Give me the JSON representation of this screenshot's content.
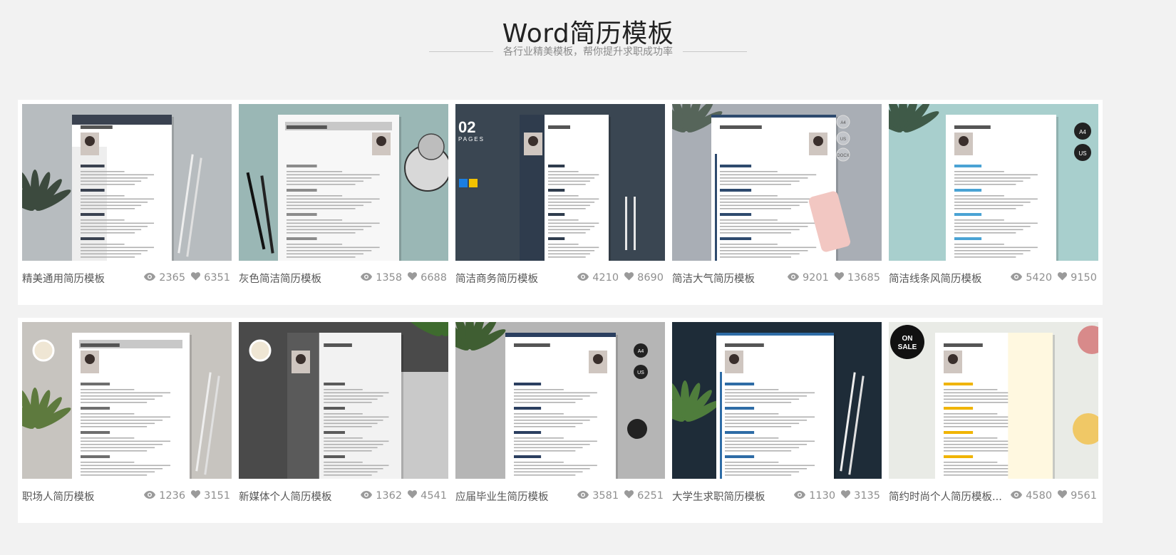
{
  "header": {
    "title": "Word简历模板",
    "subtitle": "各行业精美模板，帮你提升求职成功率"
  },
  "templates": [
    {
      "name": "精美通用简历模板",
      "views": "2365",
      "likes": "6351",
      "bg": "#b7bcbf",
      "paper": "#ffffff",
      "accent": "#3a4250",
      "plant": "#3c4a3e"
    },
    {
      "name": "灰色简洁简历模板",
      "views": "1358",
      "likes": "6688",
      "bg": "#9ab7b5",
      "paper": "#f7f7f7",
      "accent": "#8c8c8c",
      "plant": "#555555"
    },
    {
      "name": "简洁商务简历模板",
      "views": "4210",
      "likes": "8690",
      "bg": "#3a4652",
      "paper": "#ffffff",
      "accent": "#2f3c4d",
      "plant": "#f2c200"
    },
    {
      "name": "简洁大气简历模板",
      "views": "9201",
      "likes": "13685",
      "bg": "#a9aeb5",
      "paper": "#ffffff",
      "accent": "#2e4a6e",
      "plant": "#56655a"
    },
    {
      "name": "简洁线条风简历模板",
      "views": "5420",
      "likes": "9150",
      "bg": "#a8cfcd",
      "paper": "#ffffff",
      "accent": "#4aa3d4",
      "plant": "#3f5a48"
    },
    {
      "name": "职场人简历模板",
      "views": "1236",
      "likes": "3151",
      "bg": "#c7c4bf",
      "paper": "#ffffff",
      "accent": "#6e6e6e",
      "plant": "#5e7a3e"
    },
    {
      "name": "新媒体个人简历模板",
      "views": "1362",
      "likes": "4541",
      "bg": "#4a4a4a",
      "paper": "#f2f2f2",
      "accent": "#5a5a5a",
      "plant": "#3e6b2e"
    },
    {
      "name": "应届毕业生简历模板",
      "views": "3581",
      "likes": "6251",
      "bg": "#b5b5b5",
      "paper": "#ffffff",
      "accent": "#2b3f60",
      "plant": "#3f5e32"
    },
    {
      "name": "大学生求职简历模板",
      "views": "1130",
      "likes": "3135",
      "bg": "#1e2c38",
      "paper": "#ffffff",
      "accent": "#2e6ca6",
      "plant": "#4f7d3c"
    },
    {
      "name": "简约时尚个人简历模板...",
      "views": "4580",
      "likes": "9561",
      "bg": "#e9ebe6",
      "paper": "#ffffff",
      "accent": "#f0b400",
      "plant": "#d88a8a"
    }
  ],
  "icons": {
    "views": "eye-icon",
    "likes": "heart-icon"
  },
  "decor": {
    "card3_big": "02",
    "card3_small": "PAGES",
    "card5_badge1": "A4",
    "card5_badge2": "US",
    "card4_badge1": "A4",
    "card4_badge2": "US",
    "card4_badge3": "DOCX",
    "card8_badge1": "A4",
    "card8_badge2": "US",
    "card10_sale1": "ON",
    "card10_sale2": "SALE"
  }
}
